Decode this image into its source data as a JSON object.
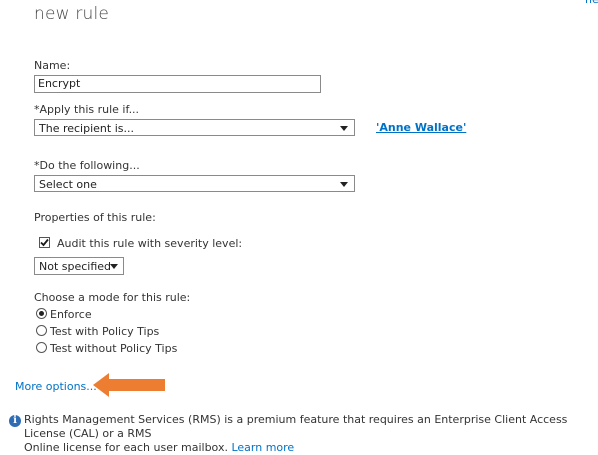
{
  "page_title": "new rule",
  "help_glyph": "he",
  "name_field": {
    "label": "Name:",
    "value": "Encrypt"
  },
  "apply_if": {
    "label": "*Apply this rule if...",
    "selected": "The recipient is...",
    "value_link": "'Anne Wallace'"
  },
  "do_following": {
    "label": "*Do the following...",
    "selected": "Select one"
  },
  "properties": {
    "label": "Properties of this rule:",
    "audit_label": "Audit this rule with severity level:",
    "audit_checked": true,
    "severity_selected": "Not specified"
  },
  "mode": {
    "label": "Choose a mode for this rule:",
    "options": [
      "Enforce",
      "Test with Policy Tips",
      "Test without Policy Tips"
    ],
    "selected_index": 0
  },
  "more_options": "More options...",
  "info": {
    "line1": "Rights Management Services (RMS) is a premium feature that requires an Enterprise Client Access License (CAL) or a RMS",
    "line2": "Online license for each user mailbox.",
    "learn_more": "Learn more"
  },
  "colors": {
    "link": "#0072c6",
    "arrow": "#ed7d31",
    "info_icon": "#2e6db4"
  }
}
